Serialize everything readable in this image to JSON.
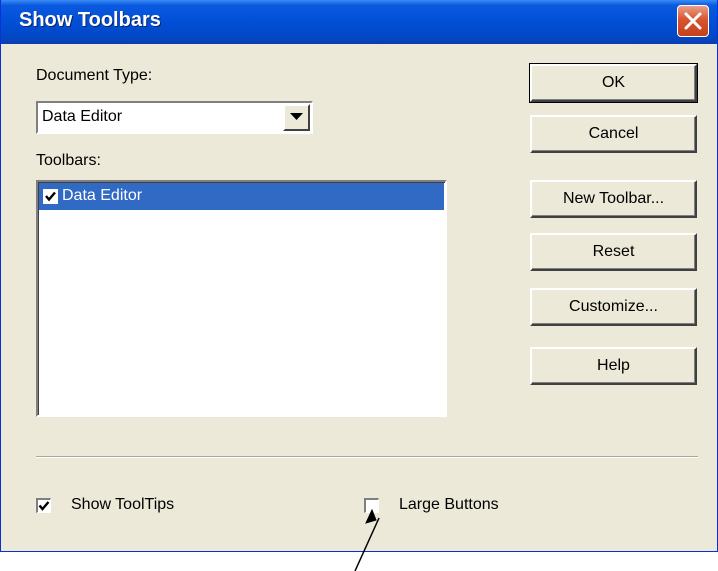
{
  "window": {
    "title": "Show Toolbars"
  },
  "document_type": {
    "label": "Document Type:",
    "selected": "Data Editor"
  },
  "toolbars": {
    "label": "Toolbars:",
    "items": [
      {
        "label": "Data Editor",
        "checked": true,
        "selected": true
      }
    ]
  },
  "buttons": {
    "ok": "OK",
    "cancel": "Cancel",
    "new_toolbar": "New Toolbar...",
    "reset": "Reset",
    "customize": "Customize...",
    "help": "Help"
  },
  "options": {
    "show_tooltips": {
      "label": "Show ToolTips",
      "checked": true
    },
    "large_buttons": {
      "label": "Large Buttons",
      "checked": false
    }
  },
  "colors": {
    "title_bar": "#0250d8",
    "selection": "#316ac5",
    "dialog_bg": "#ece9d8"
  }
}
